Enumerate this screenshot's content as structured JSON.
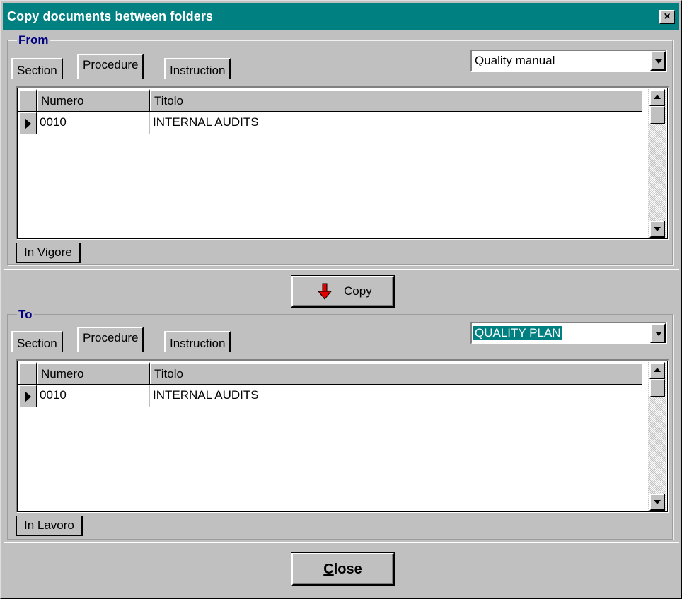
{
  "window": {
    "title": "Copy documents between folders",
    "close_glyph": "×"
  },
  "from": {
    "legend": "From",
    "tabs": [
      "Section",
      "Procedure",
      "Instruction"
    ],
    "active_tab": "Procedure",
    "folder": "Quality manual",
    "columns": [
      "Numero",
      "Titolo"
    ],
    "rows": [
      {
        "numero": "0010",
        "titolo": "INTERNAL AUDITS"
      }
    ],
    "status_tab": "In Vigore"
  },
  "copy_button": {
    "label_prefix": "C",
    "label_rest": "opy",
    "icon": "red-down-arrow-icon"
  },
  "to": {
    "legend": "To",
    "tabs": [
      "Section",
      "Procedure",
      "Instruction"
    ],
    "active_tab": "Procedure",
    "folder": "QUALITY PLAN",
    "columns": [
      "Numero",
      "Titolo"
    ],
    "rows": [
      {
        "numero": "0010",
        "titolo": "INTERNAL AUDITS"
      }
    ],
    "status_tab": "In Lavoro"
  },
  "close_button": {
    "label_prefix": "C",
    "label_rest": "lose"
  },
  "colors": {
    "title_bar": "#008080",
    "legend_text": "#000080",
    "face": "#c0c0c0",
    "selection": "#008080",
    "arrow": "#e00000"
  }
}
